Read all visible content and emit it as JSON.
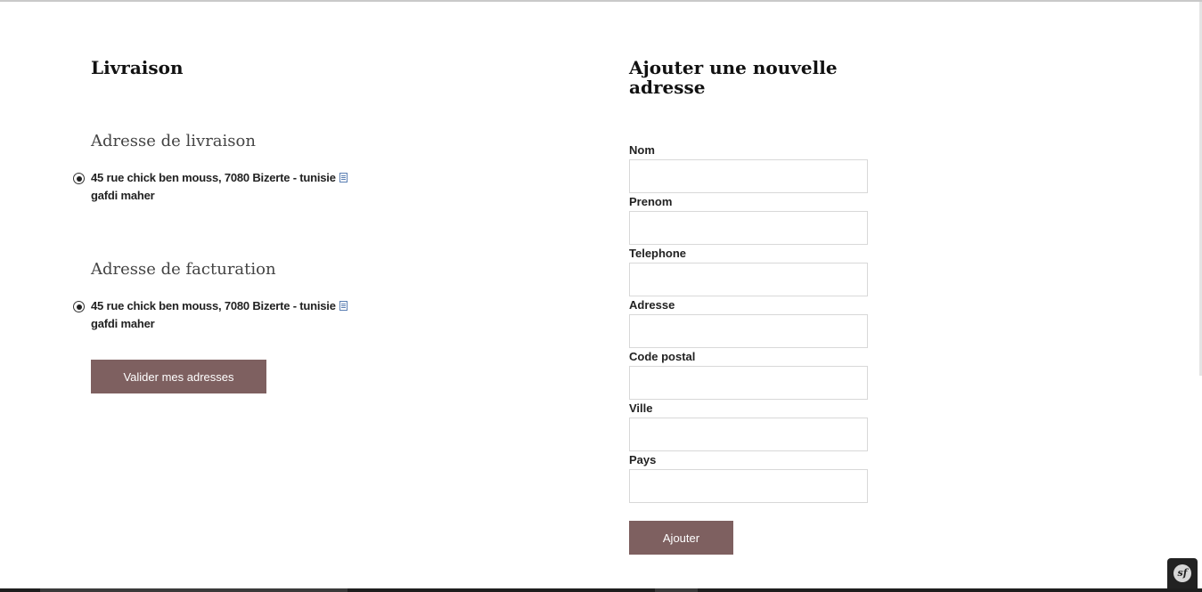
{
  "livraison": {
    "title": "Livraison",
    "delivery_heading": "Adresse de livraison",
    "delivery_address": {
      "line1": "45 rue chick ben mouss, 7080 Bizerte - tunisie",
      "line2": "gafdi maher"
    },
    "billing_heading": "Adresse de facturation",
    "billing_address": {
      "line1": "45 rue chick ben mouss, 7080 Bizerte - tunisie",
      "line2": "gafdi maher"
    },
    "validate_button": "Valider mes adresses"
  },
  "new_address": {
    "title": "Ajouter une nouvelle adresse",
    "fields": {
      "nom": {
        "label": "Nom",
        "value": ""
      },
      "prenom": {
        "label": "Prenom",
        "value": ""
      },
      "telephone": {
        "label": "Telephone",
        "value": ""
      },
      "adresse": {
        "label": "Adresse",
        "value": ""
      },
      "code_postal": {
        "label": "Code postal",
        "value": ""
      },
      "ville": {
        "label": "Ville",
        "value": ""
      },
      "pays": {
        "label": "Pays",
        "value": ""
      }
    },
    "submit_button": "Ajouter"
  },
  "debug_toolbar": {
    "icon": "symfony-icon",
    "text": "sf"
  },
  "colors": {
    "button_bg": "#7e6060",
    "button_text": "#ffffff",
    "input_border": "#d8d8d8"
  }
}
